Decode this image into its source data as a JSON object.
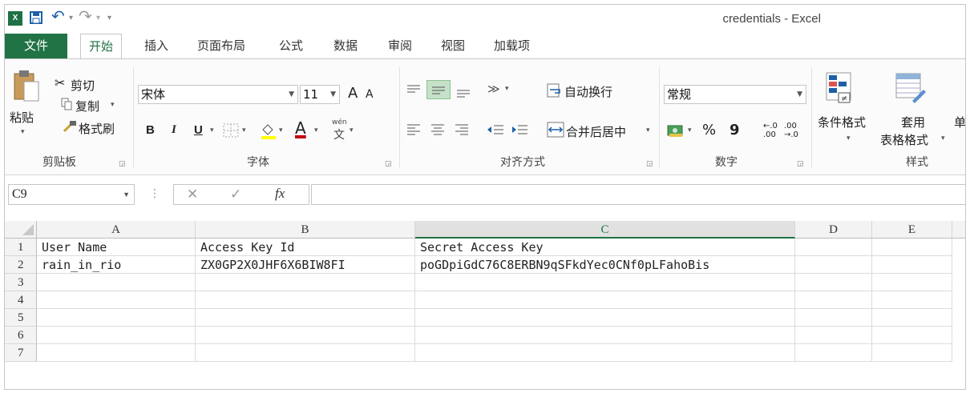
{
  "window": {
    "title": "credentials - Excel",
    "app_icon_letter": "X",
    "undo_symbol": "↶",
    "redo_symbol": "↷",
    "qat_more": "▾"
  },
  "tabs": [
    {
      "label": "文件"
    },
    {
      "label": "开始"
    },
    {
      "label": "插入"
    },
    {
      "label": "页面布局"
    },
    {
      "label": "公式"
    },
    {
      "label": "数据"
    },
    {
      "label": "审阅"
    },
    {
      "label": "视图"
    },
    {
      "label": "加载项"
    }
  ],
  "ribbon": {
    "clipboard": {
      "paste": "粘贴",
      "cut": "剪切",
      "copy": "复制",
      "format_painter": "格式刷",
      "group_label": "剪贴板"
    },
    "font": {
      "font_name": "宋体",
      "font_size": "11",
      "bold": "B",
      "italic": "I",
      "underline": "U",
      "grow": "A",
      "shrink": "A",
      "font_color": "A",
      "phonetic": "wén",
      "phonetic_char": "文",
      "group_label": "字体"
    },
    "alignment": {
      "wrap_text": "自动换行",
      "merge_center": "合并后居中",
      "group_label": "对齐方式"
    },
    "number": {
      "format": "常规",
      "percent": "%",
      "comma": "9",
      "inc_decimal": "←.0 .00",
      "dec_decimal": ".00 →.0",
      "group_label": "数字"
    },
    "styles": {
      "conditional": "条件格式",
      "table_format_1": "套用",
      "table_format_2": "表格格式",
      "cell_styles": "单",
      "group_label": "样式"
    },
    "accent_green": "#217346",
    "highlight_yellow": "#ffff00",
    "font_red": "#c00000"
  },
  "formula_bar": {
    "name_box": "C9",
    "cancel_symbol": "✕",
    "enter_symbol": "✓",
    "fx": "fx",
    "formula": ""
  },
  "sheet": {
    "columns": [
      "A",
      "B",
      "C",
      "D",
      "E"
    ],
    "selected_column": "C",
    "rows": [
      {
        "num": "1",
        "cells": [
          "User Name",
          "Access Key Id",
          "Secret Access Key",
          "",
          ""
        ]
      },
      {
        "num": "2",
        "cells": [
          "rain_in_rio",
          "ZX0GP2X0JHF6X6BIW8FI",
          "poGDpiGdC76C8ERBN9qSFkdYec0CNf0pLFahoBis",
          "",
          ""
        ]
      },
      {
        "num": "3",
        "cells": [
          "",
          "",
          "",
          "",
          ""
        ]
      },
      {
        "num": "4",
        "cells": [
          "",
          "",
          "",
          "",
          ""
        ]
      },
      {
        "num": "5",
        "cells": [
          "",
          "",
          "",
          "",
          ""
        ]
      },
      {
        "num": "6",
        "cells": [
          "",
          "",
          "",
          "",
          ""
        ]
      },
      {
        "num": "7",
        "cells": [
          "",
          "",
          "",
          "",
          ""
        ]
      }
    ]
  }
}
